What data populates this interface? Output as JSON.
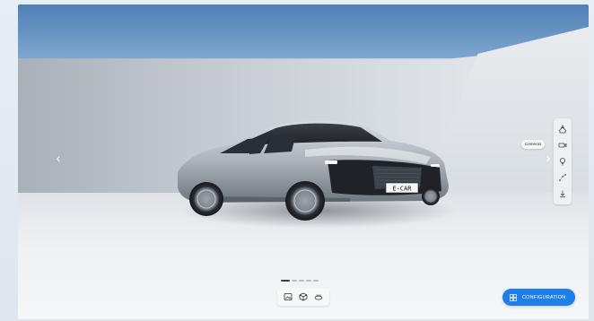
{
  "viewer": {
    "prev_label": "‹",
    "next_label": "›"
  },
  "car": {
    "plate": "E-CAR"
  },
  "side_toolbar": {
    "tooltip": "Cameras",
    "tools": [
      {
        "icon": "environment-icon"
      },
      {
        "icon": "video-camera-icon"
      },
      {
        "icon": "light-bulb-icon"
      },
      {
        "icon": "path-icon"
      },
      {
        "icon": "download-icon"
      }
    ]
  },
  "carousel": {
    "count": 5,
    "active": 0
  },
  "bottom_bar": {
    "buttons": [
      {
        "icon": "image-icon"
      },
      {
        "icon": "cube-icon"
      },
      {
        "icon": "360-view-icon"
      }
    ]
  },
  "configuration_button": {
    "label": "CONFIGURATION",
    "color": "#1f7fe6"
  }
}
